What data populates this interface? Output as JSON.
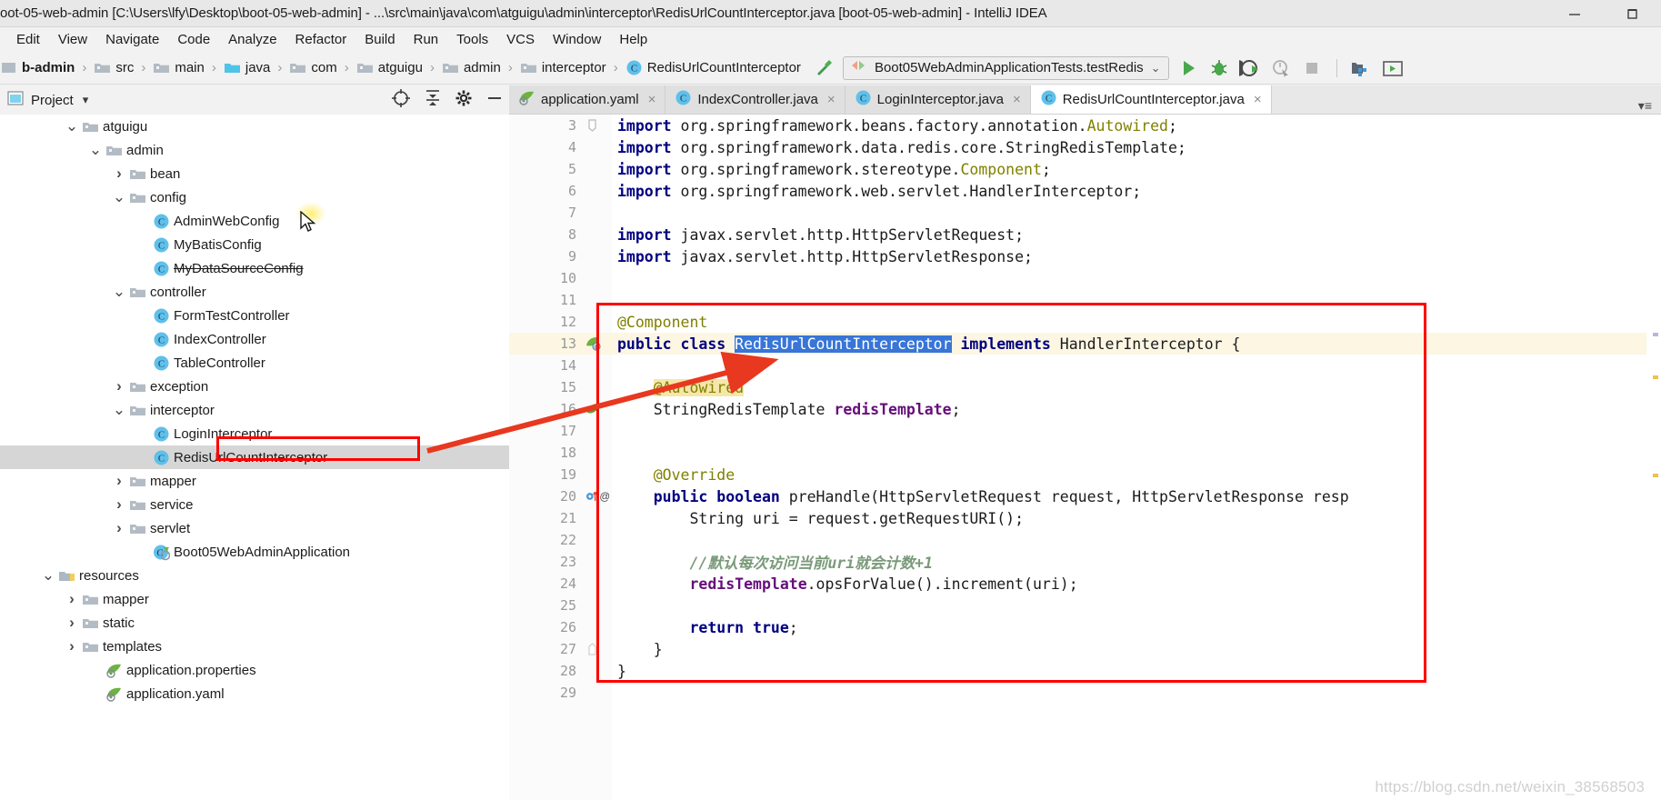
{
  "window": {
    "title": "oot-05-web-admin [C:\\Users\\lfy\\Desktop\\boot-05-web-admin] - ...\\src\\main\\java\\com\\atguigu\\admin\\interceptor\\RedisUrlCountInterceptor.java [boot-05-web-admin] - IntelliJ IDEA",
    "minimize": "—",
    "restore": "❐"
  },
  "menubar": {
    "items": [
      "Edit",
      "View",
      "Navigate",
      "Code",
      "Analyze",
      "Refactor",
      "Build",
      "Run",
      "Tools",
      "VCS",
      "Window",
      "Help"
    ]
  },
  "breadcrumb": {
    "items": [
      {
        "label": "b-admin",
        "icon": "module-icon",
        "bold": true
      },
      {
        "label": "src",
        "icon": "folder-gray-icon",
        "bold": false
      },
      {
        "label": "main",
        "icon": "folder-gray-icon",
        "bold": false
      },
      {
        "label": "java",
        "icon": "folder-blue-icon",
        "bold": false
      },
      {
        "label": "com",
        "icon": "package-icon",
        "bold": false
      },
      {
        "label": "atguigu",
        "icon": "package-icon",
        "bold": false
      },
      {
        "label": "admin",
        "icon": "package-icon",
        "bold": false
      },
      {
        "label": "interceptor",
        "icon": "package-icon",
        "bold": false
      },
      {
        "label": "RedisUrlCountInterceptor",
        "icon": "class-icon",
        "bold": false
      }
    ]
  },
  "toolbar": {
    "hammer_icon": "build-hammer-icon",
    "run_config": "Boot05WebAdminApplicationTests.testRedis",
    "run_config_dropdown": "⌄",
    "buttons": [
      {
        "name": "run-button",
        "icon": "play-icon"
      },
      {
        "name": "debug-button",
        "icon": "bug-icon"
      },
      {
        "name": "run-with-coverage-button",
        "icon": "coverage-icon"
      },
      {
        "name": "profile-button",
        "icon": "profiler-icon"
      },
      {
        "name": "stop-button",
        "icon": "stop-icon"
      },
      {
        "name": "database-button",
        "icon": "database-icon"
      },
      {
        "name": "terminal-button",
        "icon": "terminal-icon"
      }
    ]
  },
  "project_panel": {
    "title": "Project",
    "dropdown": "▾",
    "actions": [
      {
        "name": "locate-file-button",
        "icon": "crosshair-icon"
      },
      {
        "name": "collapse-all-button",
        "icon": "collapse-all-icon"
      },
      {
        "name": "settings-button",
        "icon": "gear-icon"
      },
      {
        "name": "hide-button",
        "icon": "minus-icon"
      }
    ]
  },
  "tree": [
    {
      "label": "atguigu",
      "indent": 4,
      "arrow": "down",
      "icon": "package-icon",
      "selected": false,
      "strike": false
    },
    {
      "label": "admin",
      "indent": 5,
      "arrow": "down",
      "icon": "package-icon",
      "selected": false,
      "strike": false
    },
    {
      "label": "bean",
      "indent": 6,
      "arrow": "right",
      "icon": "package-icon",
      "selected": false,
      "strike": false
    },
    {
      "label": "config",
      "indent": 6,
      "arrow": "down",
      "icon": "package-icon",
      "selected": false,
      "strike": false
    },
    {
      "label": "AdminWebConfig",
      "indent": 7,
      "arrow": "none",
      "icon": "class-icon",
      "selected": false,
      "strike": false
    },
    {
      "label": "MyBatisConfig",
      "indent": 7,
      "arrow": "none",
      "icon": "class-icon",
      "selected": false,
      "strike": false
    },
    {
      "label": "MyDataSourceConfig",
      "indent": 7,
      "arrow": "none",
      "icon": "class-icon",
      "selected": false,
      "strike": true
    },
    {
      "label": "controller",
      "indent": 6,
      "arrow": "down",
      "icon": "package-icon",
      "selected": false,
      "strike": false
    },
    {
      "label": "FormTestController",
      "indent": 7,
      "arrow": "none",
      "icon": "class-icon",
      "selected": false,
      "strike": false
    },
    {
      "label": "IndexController",
      "indent": 7,
      "arrow": "none",
      "icon": "class-icon",
      "selected": false,
      "strike": false
    },
    {
      "label": "TableController",
      "indent": 7,
      "arrow": "none",
      "icon": "class-icon",
      "selected": false,
      "strike": false
    },
    {
      "label": "exception",
      "indent": 6,
      "arrow": "right",
      "icon": "package-icon",
      "selected": false,
      "strike": false
    },
    {
      "label": "interceptor",
      "indent": 6,
      "arrow": "down",
      "icon": "package-icon",
      "selected": false,
      "strike": false
    },
    {
      "label": "LoginInterceptor",
      "indent": 7,
      "arrow": "none",
      "icon": "class-icon",
      "selected": false,
      "strike": false
    },
    {
      "label": "RedisUrlCountInterceptor",
      "indent": 7,
      "arrow": "none",
      "icon": "class-icon",
      "selected": true,
      "strike": false
    },
    {
      "label": "mapper",
      "indent": 6,
      "arrow": "right",
      "icon": "package-icon",
      "selected": false,
      "strike": false
    },
    {
      "label": "service",
      "indent": 6,
      "arrow": "right",
      "icon": "package-icon",
      "selected": false,
      "strike": false
    },
    {
      "label": "servlet",
      "indent": 6,
      "arrow": "right",
      "icon": "package-icon",
      "selected": false,
      "strike": false
    },
    {
      "label": "Boot05WebAdminApplication",
      "indent": 7,
      "arrow": "none",
      "icon": "spring-class-icon",
      "selected": false,
      "strike": false
    },
    {
      "label": "resources",
      "indent": 3,
      "arrow": "down",
      "icon": "resources-folder-icon",
      "selected": false,
      "strike": false
    },
    {
      "label": "mapper",
      "indent": 4,
      "arrow": "right",
      "icon": "folder-gray-icon",
      "selected": false,
      "strike": false
    },
    {
      "label": "static",
      "indent": 4,
      "arrow": "right",
      "icon": "folder-gray-icon",
      "selected": false,
      "strike": false
    },
    {
      "label": "templates",
      "indent": 4,
      "arrow": "right",
      "icon": "folder-gray-icon",
      "selected": false,
      "strike": false
    },
    {
      "label": "application.properties",
      "indent": 5,
      "arrow": "none",
      "icon": "spring-file-icon",
      "selected": false,
      "strike": false
    },
    {
      "label": "application.yaml",
      "indent": 5,
      "arrow": "none",
      "icon": "spring-file-icon",
      "selected": false,
      "strike": false
    }
  ],
  "editor_tabs": [
    {
      "label": "application.yaml",
      "icon": "spring-file-icon",
      "active": false,
      "close": "×"
    },
    {
      "label": "IndexController.java",
      "icon": "class-icon",
      "active": false,
      "close": "×"
    },
    {
      "label": "LoginInterceptor.java",
      "icon": "class-icon",
      "active": false,
      "close": "×"
    },
    {
      "label": "RedisUrlCountInterceptor.java",
      "icon": "class-icon",
      "active": true,
      "close": "×"
    }
  ],
  "code": {
    "lines": [
      {
        "num": "3",
        "gutter": "fold",
        "highlight": false,
        "tokens": [
          {
            "t": "import ",
            "c": "kw"
          },
          {
            "t": "org.springframework.beans.factory.annotation.",
            "c": "plain"
          },
          {
            "t": "Autowired",
            "c": "type-hl"
          },
          {
            "t": ";",
            "c": "plain"
          }
        ]
      },
      {
        "num": "4",
        "gutter": "",
        "highlight": false,
        "tokens": [
          {
            "t": "import ",
            "c": "kw"
          },
          {
            "t": "org.springframework.data.redis.core.StringRedisTemplate;",
            "c": "plain"
          }
        ]
      },
      {
        "num": "5",
        "gutter": "",
        "highlight": false,
        "tokens": [
          {
            "t": "import ",
            "c": "kw"
          },
          {
            "t": "org.springframework.stereotype.",
            "c": "plain"
          },
          {
            "t": "Component",
            "c": "type-hl"
          },
          {
            "t": ";",
            "c": "plain"
          }
        ]
      },
      {
        "num": "6",
        "gutter": "",
        "highlight": false,
        "tokens": [
          {
            "t": "import ",
            "c": "kw"
          },
          {
            "t": "org.springframework.web.servlet.HandlerInterceptor;",
            "c": "plain"
          }
        ]
      },
      {
        "num": "7",
        "gutter": "",
        "highlight": false,
        "tokens": []
      },
      {
        "num": "8",
        "gutter": "",
        "highlight": false,
        "tokens": [
          {
            "t": "import ",
            "c": "kw"
          },
          {
            "t": "javax.servlet.http.HttpServletRequest;",
            "c": "plain"
          }
        ]
      },
      {
        "num": "9",
        "gutter": "",
        "highlight": false,
        "tokens": [
          {
            "t": "import ",
            "c": "kw"
          },
          {
            "t": "javax.servlet.http.HttpServletResponse;",
            "c": "plain"
          }
        ]
      },
      {
        "num": "10",
        "gutter": "",
        "highlight": false,
        "tokens": []
      },
      {
        "num": "11",
        "gutter": "",
        "highlight": false,
        "tokens": []
      },
      {
        "num": "12",
        "gutter": "",
        "highlight": false,
        "tokens": [
          {
            "t": "@Component",
            "c": "ann"
          }
        ]
      },
      {
        "num": "13",
        "gutter": "spring-bean",
        "highlight": true,
        "tokens": [
          {
            "t": "public class ",
            "c": "kw"
          },
          {
            "t": "RedisUrlCountInterceptor",
            "c": "sel"
          },
          {
            "t": " ",
            "c": "plain"
          },
          {
            "t": "implements",
            "c": "kw"
          },
          {
            "t": " HandlerInterceptor {",
            "c": "plain"
          }
        ]
      },
      {
        "num": "14",
        "gutter": "",
        "highlight": false,
        "tokens": []
      },
      {
        "num": "15",
        "gutter": "",
        "highlight": false,
        "tokens": [
          {
            "t": "    ",
            "c": "plain"
          },
          {
            "t": "@Autowired",
            "c": "ann-hl"
          }
        ]
      },
      {
        "num": "16",
        "gutter": "spring-leaf",
        "highlight": false,
        "tokens": [
          {
            "t": "    StringRedisTemplate ",
            "c": "plain"
          },
          {
            "t": "redisTemplate",
            "c": "field"
          },
          {
            "t": ";",
            "c": "plain"
          }
        ]
      },
      {
        "num": "17",
        "gutter": "",
        "highlight": false,
        "tokens": []
      },
      {
        "num": "18",
        "gutter": "",
        "highlight": false,
        "tokens": []
      },
      {
        "num": "19",
        "gutter": "",
        "highlight": false,
        "tokens": [
          {
            "t": "    ",
            "c": "plain"
          },
          {
            "t": "@Override",
            "c": "ann"
          }
        ]
      },
      {
        "num": "20",
        "gutter": "override-impl",
        "highlight": false,
        "tokens": [
          {
            "t": "    public boolean ",
            "c": "kw"
          },
          {
            "t": "preHandle(HttpServletRequest request, HttpServletResponse resp",
            "c": "plain"
          }
        ]
      },
      {
        "num": "21",
        "gutter": "",
        "highlight": false,
        "tokens": [
          {
            "t": "        String uri = request.getRequestURI();",
            "c": "plain"
          }
        ]
      },
      {
        "num": "22",
        "gutter": "",
        "highlight": false,
        "tokens": []
      },
      {
        "num": "23",
        "gutter": "",
        "highlight": false,
        "tokens": [
          {
            "t": "        ",
            "c": "plain"
          },
          {
            "t": "//默认每次访问当前uri就会计数+1",
            "c": "cmt-zh"
          }
        ]
      },
      {
        "num": "24",
        "gutter": "",
        "highlight": false,
        "tokens": [
          {
            "t": "        ",
            "c": "plain"
          },
          {
            "t": "redisTemplate",
            "c": "field"
          },
          {
            "t": ".opsForValue().increment(uri);",
            "c": "plain"
          }
        ]
      },
      {
        "num": "25",
        "gutter": "",
        "highlight": false,
        "tokens": []
      },
      {
        "num": "26",
        "gutter": "",
        "highlight": false,
        "tokens": [
          {
            "t": "        ",
            "c": "kw"
          },
          {
            "t": "return true",
            "c": "kw"
          },
          {
            "t": ";",
            "c": "plain"
          }
        ]
      },
      {
        "num": "27",
        "gutter": "fold-end",
        "highlight": false,
        "tokens": [
          {
            "t": "    }",
            "c": "plain"
          }
        ]
      },
      {
        "num": "28",
        "gutter": "",
        "highlight": false,
        "tokens": [
          {
            "t": "}",
            "c": "plain"
          }
        ]
      },
      {
        "num": "29",
        "gutter": "",
        "highlight": false,
        "tokens": []
      }
    ]
  },
  "annotation": {
    "box_color": "#ff0000",
    "arrow_color": "#e8381f"
  },
  "watermark": "https://blog.csdn.net/weixin_38568503"
}
